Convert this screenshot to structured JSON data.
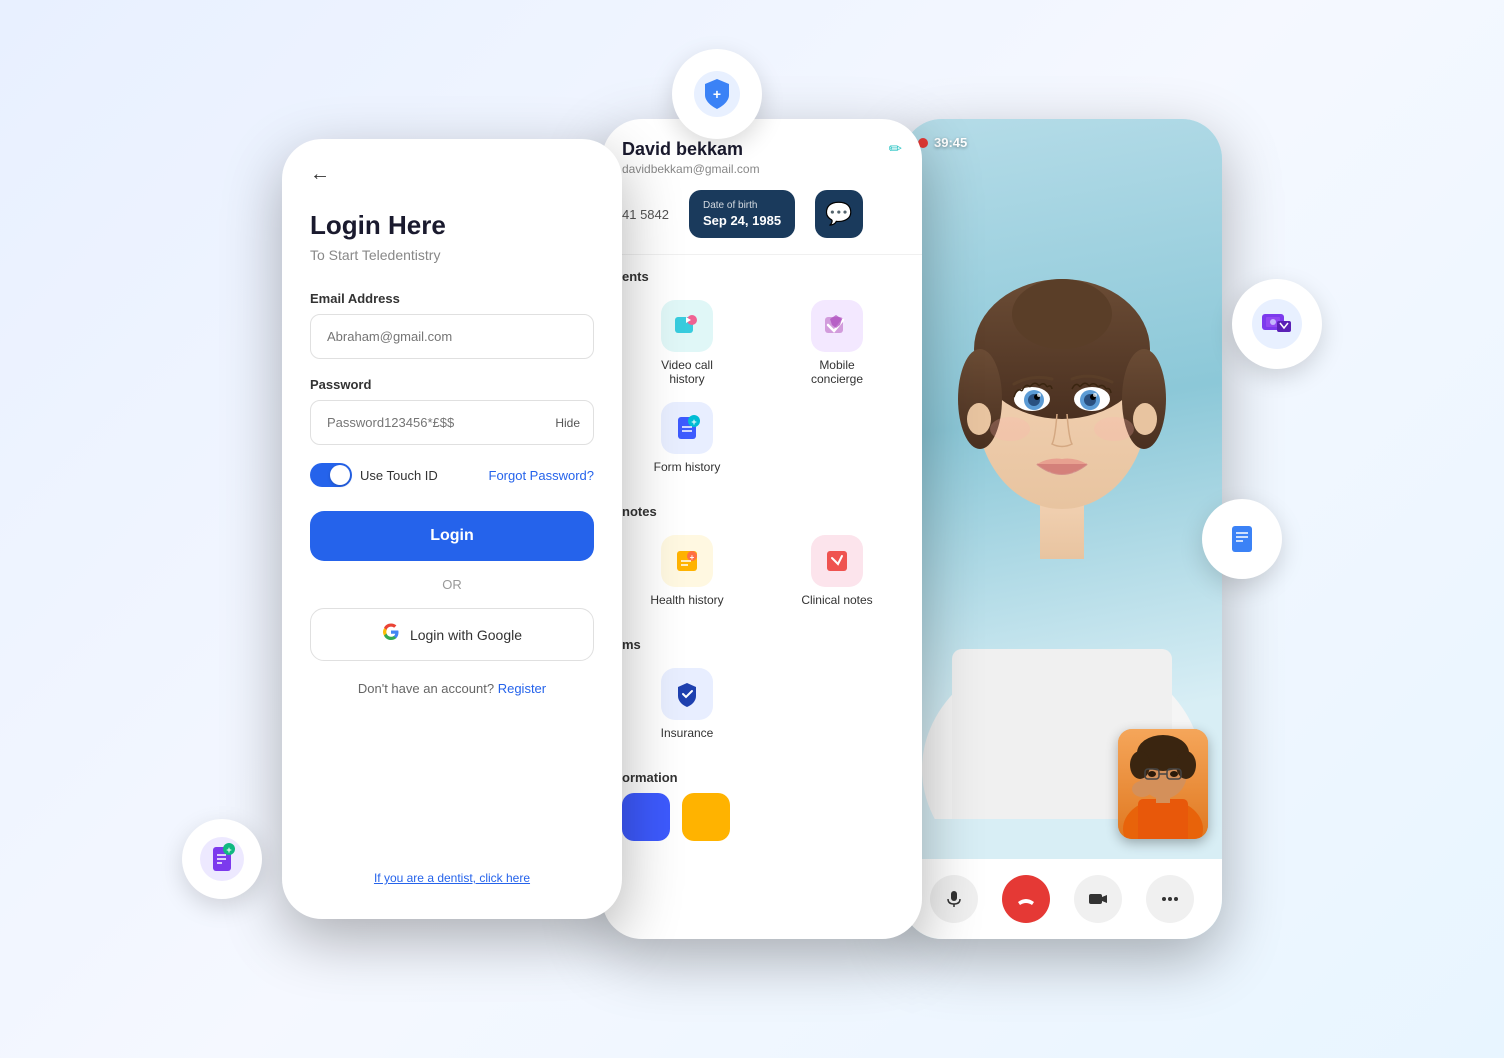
{
  "scene": {
    "bg_color": "#eef2ff"
  },
  "badges": {
    "shield_icon": "🛡",
    "photo_icon": "🖼",
    "doc_right_icon": "📄",
    "doc_left_icon": "📝"
  },
  "login_phone": {
    "back_arrow": "←",
    "title": "Login Here",
    "subtitle": "To Start Teledentistry",
    "email_label": "Email Address",
    "email_placeholder": "Abraham@gmail.com",
    "password_label": "Password",
    "password_placeholder": "Password123456*£$$",
    "hide_label": "Hide",
    "touch_id_label": "Use Touch ID",
    "forgot_label": "Forgot Password?",
    "login_btn": "Login",
    "or_text": "OR",
    "google_btn": "Login with Google",
    "register_text": "Don't have an account?",
    "register_link": "Register",
    "dentist_link": "If you are a dentist, click here"
  },
  "menu_phone": {
    "profile_name": "David bekkam",
    "profile_email": "davidbekkam@gmail.com",
    "profile_phone": "41 5842",
    "dob_label": "Date of birth",
    "dob_value": "Sep 24, 1985",
    "sections": [
      {
        "label": "ents",
        "items": [
          {
            "id": "video-call",
            "icon": "📅",
            "icon_color": "#e8f5f5",
            "label": "Video call history"
          },
          {
            "id": "mobile-concierge",
            "icon": "🏠",
            "icon_color": "#f0e8ff",
            "label": "Mobile concierge"
          }
        ]
      },
      {
        "label": "",
        "items": [
          {
            "id": "form-history",
            "icon": "📋",
            "icon_color": "#e8f0ff",
            "label": "Form history"
          }
        ]
      },
      {
        "label": "notes",
        "items": [
          {
            "id": "health-history",
            "icon": "📊",
            "icon_color": "#fff8e8",
            "label": "Health history"
          },
          {
            "id": "clinical-notes",
            "icon": "📋",
            "icon_color": "#ffe8e8",
            "label": "Clinical notes"
          }
        ]
      },
      {
        "label": "ms",
        "items": [
          {
            "id": "insurance",
            "icon": "🛡",
            "icon_color": "#e8f0ff",
            "label": "Insurance"
          }
        ]
      }
    ],
    "bottom_label": "ormation"
  },
  "video_phone": {
    "rec_time": "39:45",
    "mic_icon": "🎤",
    "end_icon": "📞",
    "camera_icon": "📹",
    "more_icon": "⋯"
  }
}
